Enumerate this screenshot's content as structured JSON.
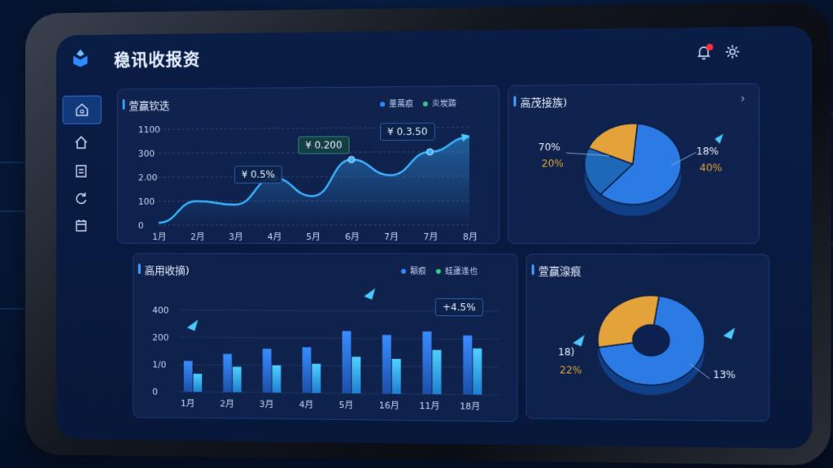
{
  "app": {
    "title": "稳讯收报资"
  },
  "colors": {
    "accent": "#3ea0ff",
    "orange": "#e3a23a",
    "blue": "#2c7be5",
    "cyan": "#4ac8ff"
  },
  "sidebar": {
    "items": [
      {
        "icon": "dashboard-icon",
        "active": true
      },
      {
        "icon": "home-icon"
      },
      {
        "icon": "document-icon"
      },
      {
        "icon": "refresh-icon"
      },
      {
        "icon": "calendar-icon"
      }
    ]
  },
  "line_panel": {
    "title": "萱赢钦迭",
    "legend": [
      "量萬痕",
      "炎炭踌"
    ],
    "callouts": [
      "¥ 0.5%",
      "¥ 0.200",
      "¥ 0.3.50"
    ]
  },
  "pie_panel": {
    "title": "高茂接族)",
    "labels": [
      "70%",
      "20%",
      "18%",
      "40%"
    ]
  },
  "bar_panel": {
    "title": "高用收摘)",
    "legend": [
      "顜痕",
      "蛙蘆逢也"
    ],
    "callout": "+4.5%"
  },
  "donut_panel": {
    "title": "萱赢湶痕",
    "labels": [
      "18)",
      "22%",
      "13%"
    ]
  },
  "chart_data": [
    {
      "type": "line",
      "title": "萱赢钦迭",
      "x": [
        "1月",
        "2月",
        "3月",
        "4月",
        "5月",
        "6月",
        "7月",
        "7月",
        "8月"
      ],
      "y_ticks": [
        "0",
        "100",
        "2.00",
        "300",
        "1100"
      ],
      "ylim": [
        0,
        400
      ],
      "series": [
        {
          "values": [
            10,
            100,
            85,
            195,
            120,
            270,
            205,
            300,
            360
          ]
        }
      ]
    },
    {
      "type": "pie",
      "title": "高茂接族)",
      "labels": [
        "70%",
        "20%"
      ],
      "values": [
        60,
        20,
        20
      ]
    },
    {
      "type": "bar",
      "title": "高用收摘)",
      "categories": [
        "1月",
        "2月",
        "3月",
        "4月",
        "5月",
        "16月",
        "11月",
        "18月"
      ],
      "y_ticks": [
        "0",
        "1/0",
        "200",
        "400"
      ],
      "ylim": [
        0,
        450
      ],
      "series": [
        {
          "name": "顜痕",
          "values": [
            170,
            210,
            240,
            250,
            340,
            320,
            340,
            320
          ]
        },
        {
          "name": "蛙蘆逢也",
          "values": [
            100,
            140,
            150,
            160,
            200,
            190,
            240,
            250
          ]
        }
      ]
    },
    {
      "type": "pie",
      "title": "萱赢湶痕",
      "labels": [
        "18)",
        "22%",
        "13%"
      ],
      "values": [
        70,
        30
      ]
    }
  ]
}
